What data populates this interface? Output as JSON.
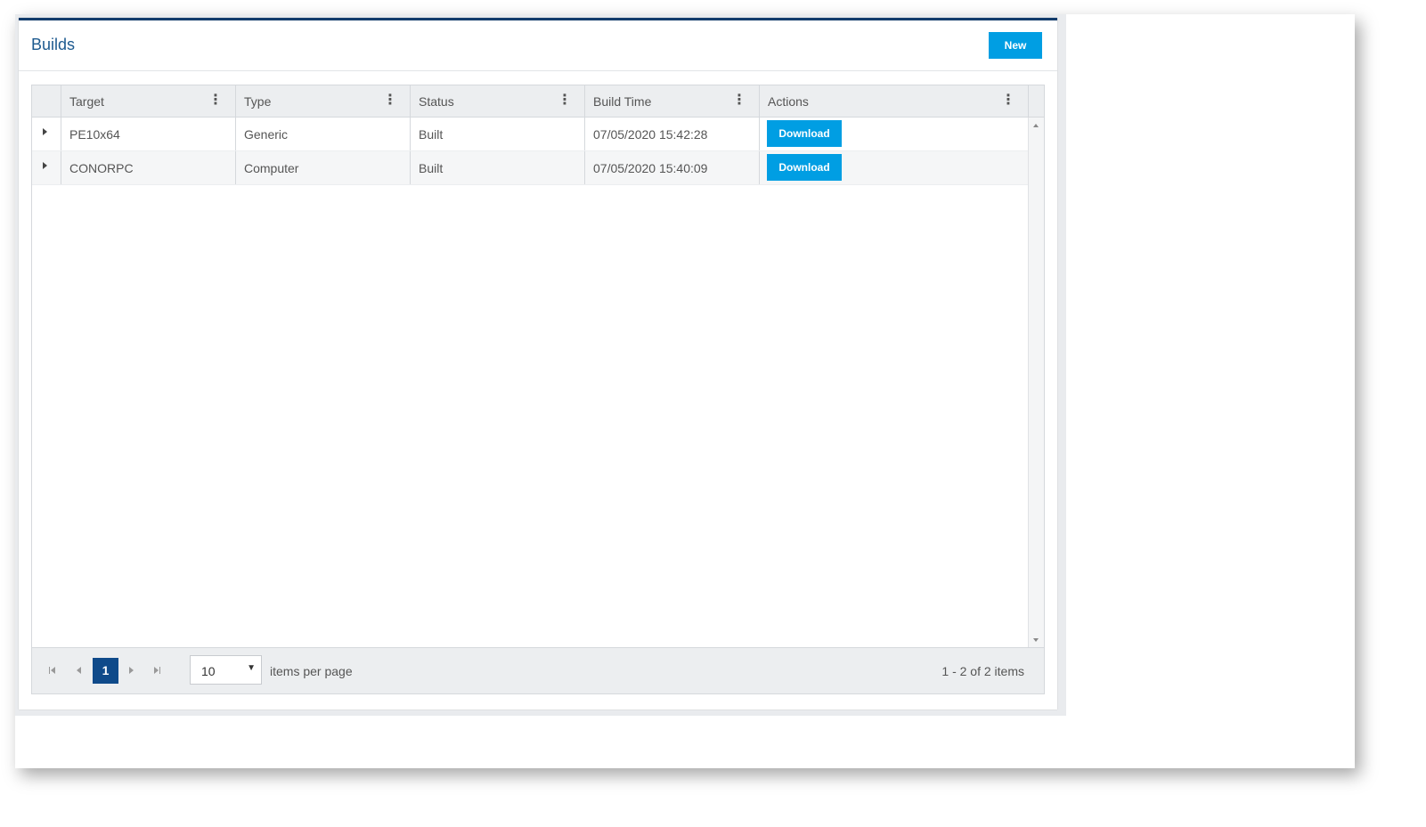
{
  "panel": {
    "title": "Builds",
    "new_label": "New"
  },
  "grid": {
    "columns": [
      "Target",
      "Type",
      "Status",
      "Build Time",
      "Actions"
    ],
    "rows": [
      {
        "target": "PE10x64",
        "type": "Generic",
        "status": "Built",
        "build_time": "07/05/2020 15:42:28",
        "action_label": "Download"
      },
      {
        "target": "CONORPC",
        "type": "Computer",
        "status": "Built",
        "build_time": "07/05/2020 15:40:09",
        "action_label": "Download"
      }
    ]
  },
  "pager": {
    "current_page": "1",
    "page_size": "10",
    "items_per_page_label": "items per page",
    "info": "1 - 2 of 2 items"
  },
  "colors": {
    "accent": "#009ee3",
    "header_bar": "#123c6b",
    "title": "#1d5a8f",
    "active_page": "#0f4a8a"
  }
}
